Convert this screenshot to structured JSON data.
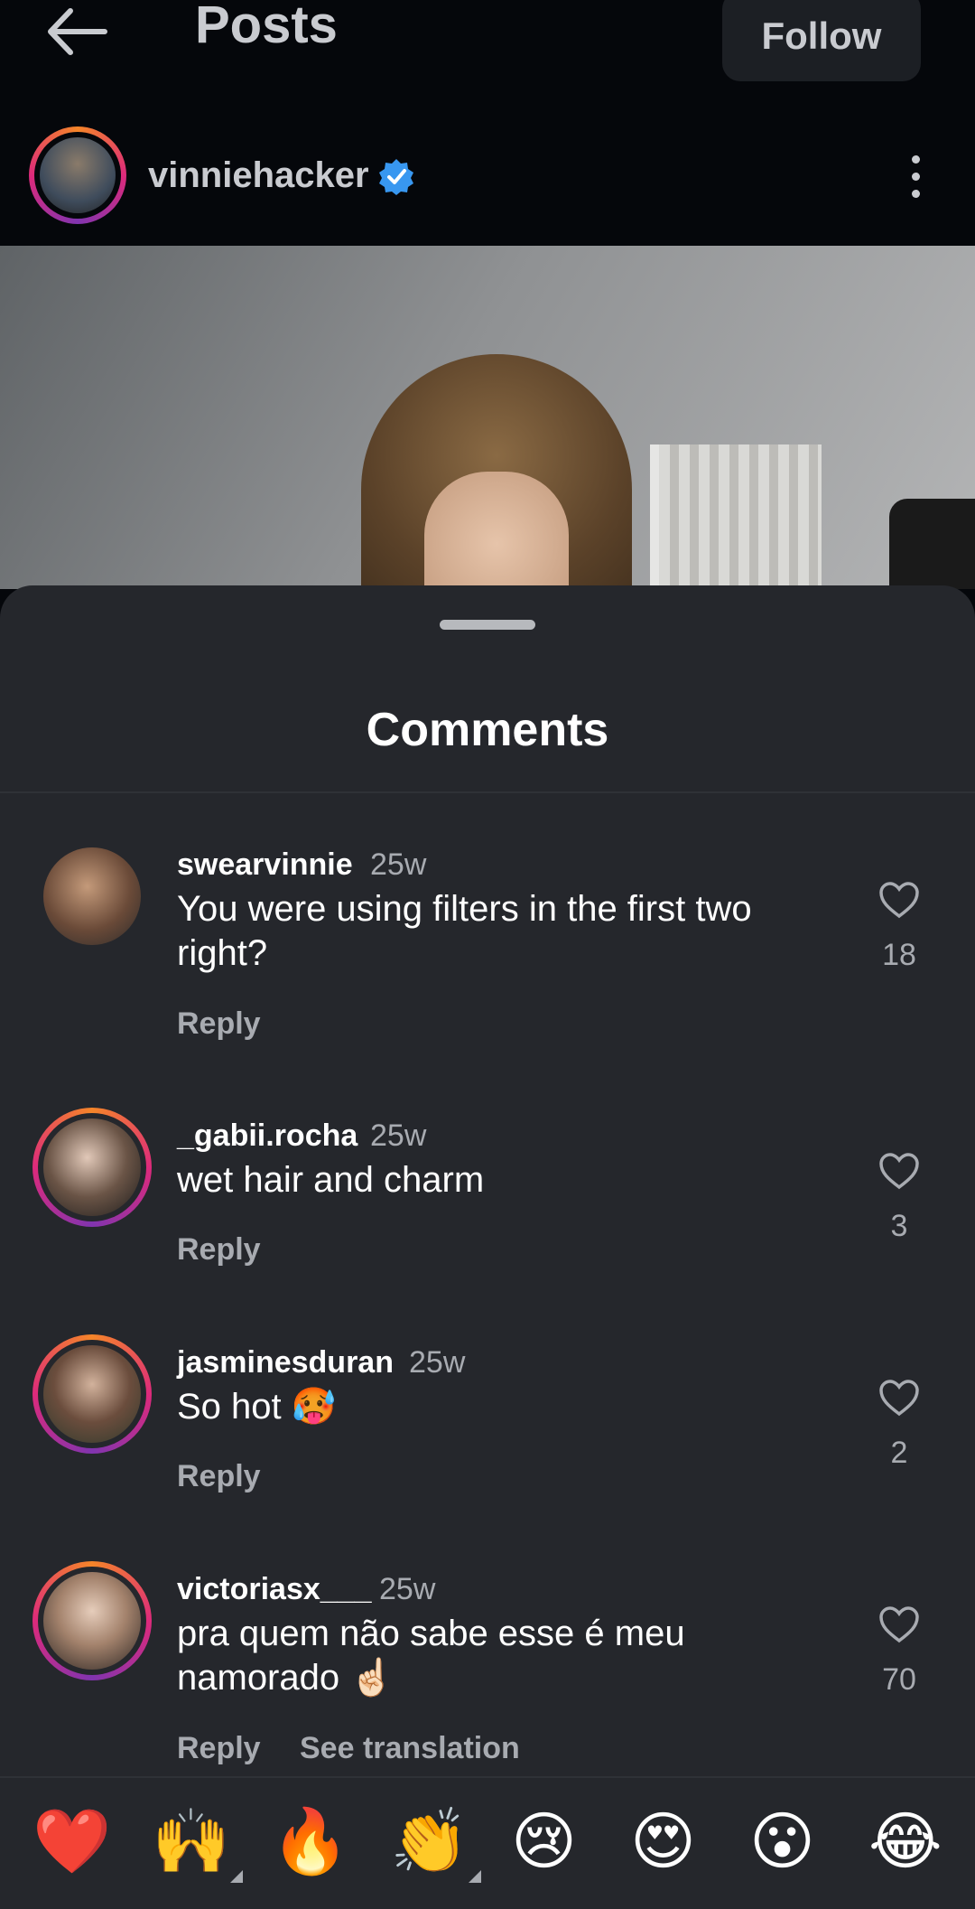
{
  "header": {
    "title": "Posts",
    "follow_label": "Follow"
  },
  "post": {
    "username": "vinniehacker"
  },
  "sheet": {
    "title": "Comments"
  },
  "comments": [
    {
      "user": "swearvinnie",
      "time": "25w",
      "text": "You were using filters in the first two right?",
      "reply": "Reply",
      "likes": "18"
    },
    {
      "user": "_gabii.rocha",
      "time": "25w",
      "text": "wet hair and charm",
      "reply": "Reply",
      "likes": "3"
    },
    {
      "user": "jasminesduran",
      "time": "25w",
      "text": "So hot 🥵",
      "reply": "Reply",
      "likes": "2"
    },
    {
      "user": "victoriasx___",
      "time": "25w",
      "text": "pra quem não sabe esse é meu namorado ☝🏻",
      "reply": "Reply",
      "see_translation": "See translation",
      "likes": "70"
    }
  ],
  "reactions": [
    "❤️",
    "🙌",
    "🔥",
    "👏",
    "😢",
    "😍",
    "😮",
    "😂"
  ],
  "colors": {
    "background": "#05070b",
    "sheet": "#25272c",
    "muted": "#a8abb1",
    "verified": "#3897f0"
  },
  "icons": [
    "back-arrow-icon",
    "verified-badge-icon",
    "more-vertical-icon",
    "heart-outline-icon"
  ]
}
